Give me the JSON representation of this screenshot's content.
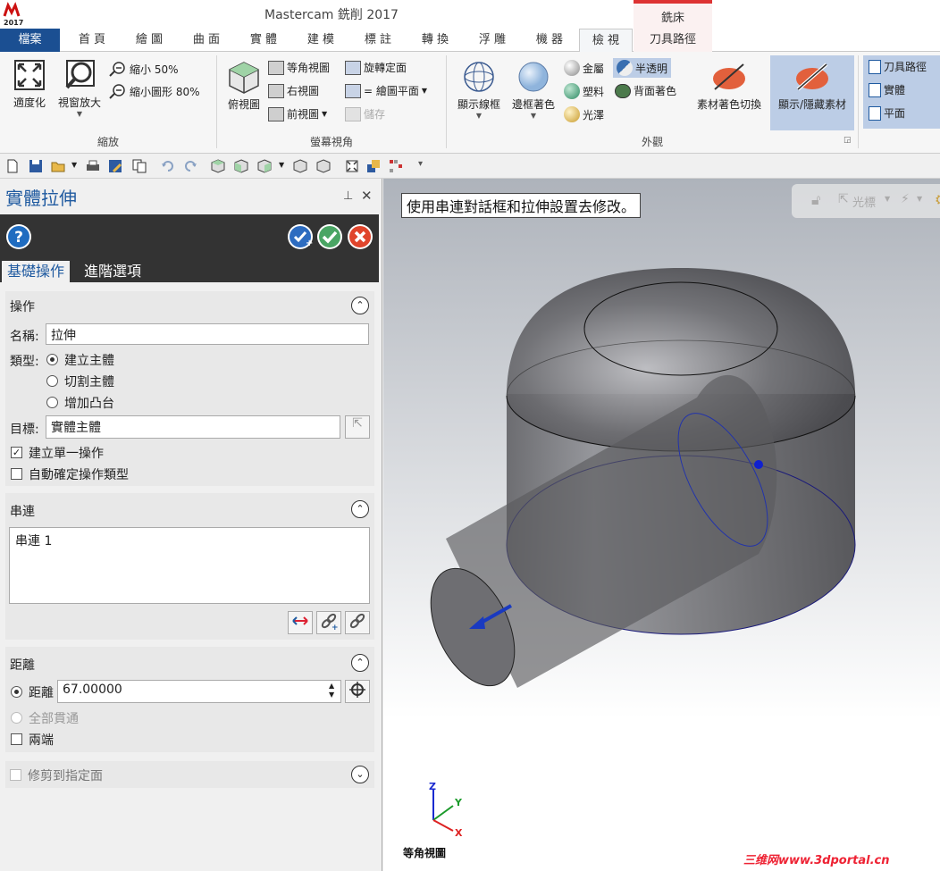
{
  "app": {
    "title": "Mastercam 銑削 2017",
    "context_tab": "銑床",
    "logo_text": "M 2017"
  },
  "menu": {
    "tabs": [
      "檔案",
      "首 頁",
      "繪 圖",
      "曲 面",
      "實 體",
      "建 模",
      "標 註",
      "轉 換",
      "浮 雕",
      "機 器",
      "檢 視",
      "刀具路徑"
    ],
    "active": "檢 視"
  },
  "ribbon": {
    "zoom": {
      "fit": "適度化",
      "window": "視窗放大",
      "zoom50": "縮小 50%",
      "zoom80": "縮小圖形 80%",
      "label": "縮放"
    },
    "views": {
      "top": "俯視圖",
      "iso": "等角視圖",
      "right": "右視圖",
      "front": "前視圖",
      "rotate": "旋轉定面",
      "cplane": "= 繪圖平面",
      "save": "儲存",
      "label": "螢幕視角"
    },
    "appearance": {
      "wireframe": "顯示線框",
      "shaded": "邊框著色",
      "metal": "金屬",
      "plastic": "塑料",
      "gloss": "光澤",
      "translucent": "半透明",
      "backface": "背面著色",
      "stock_toggle": "素材著色切換",
      "show_stock": "顯示/隱藏素材",
      "label": "外觀"
    },
    "managers": {
      "toolpaths": "刀具路徑",
      "solids": "實體",
      "planes": "平面"
    }
  },
  "panel": {
    "title": "實體拉伸",
    "tabs": [
      "基礎操作",
      "進階選項"
    ],
    "operation": {
      "header": "操作",
      "name_label": "名稱:",
      "name_value": "拉伸",
      "type_label": "類型:",
      "types": [
        "建立主體",
        "切割主體",
        "增加凸台"
      ],
      "selected_type": "建立主體",
      "target_label": "目標:",
      "target_value": "實體主體",
      "single_op": "建立單一操作",
      "single_op_checked": true,
      "auto_type": "自動確定操作類型",
      "auto_type_checked": false
    },
    "chain": {
      "header": "串連",
      "items": [
        "串連  1"
      ]
    },
    "distance": {
      "header": "距離",
      "dist_label": "距離",
      "dist_value": "67.00000",
      "through_all": "全部貫通",
      "both_sides": "兩端"
    },
    "trim": {
      "header": "修剪到指定面"
    }
  },
  "viewport": {
    "hint": "使用串連對話框和拉伸設置去修改。",
    "view_name": "等角視圖",
    "cursor_label": "光標",
    "axes": {
      "x": "X",
      "y": "Y",
      "z": "Z"
    },
    "watermark": "三维网www.3dportal.cn"
  },
  "colors": {
    "file_tab": "#1b4f92",
    "accent": "#1f5aa0",
    "ok": "#4aa564",
    "cancel": "#e0452c",
    "selected": "#bccde6"
  }
}
